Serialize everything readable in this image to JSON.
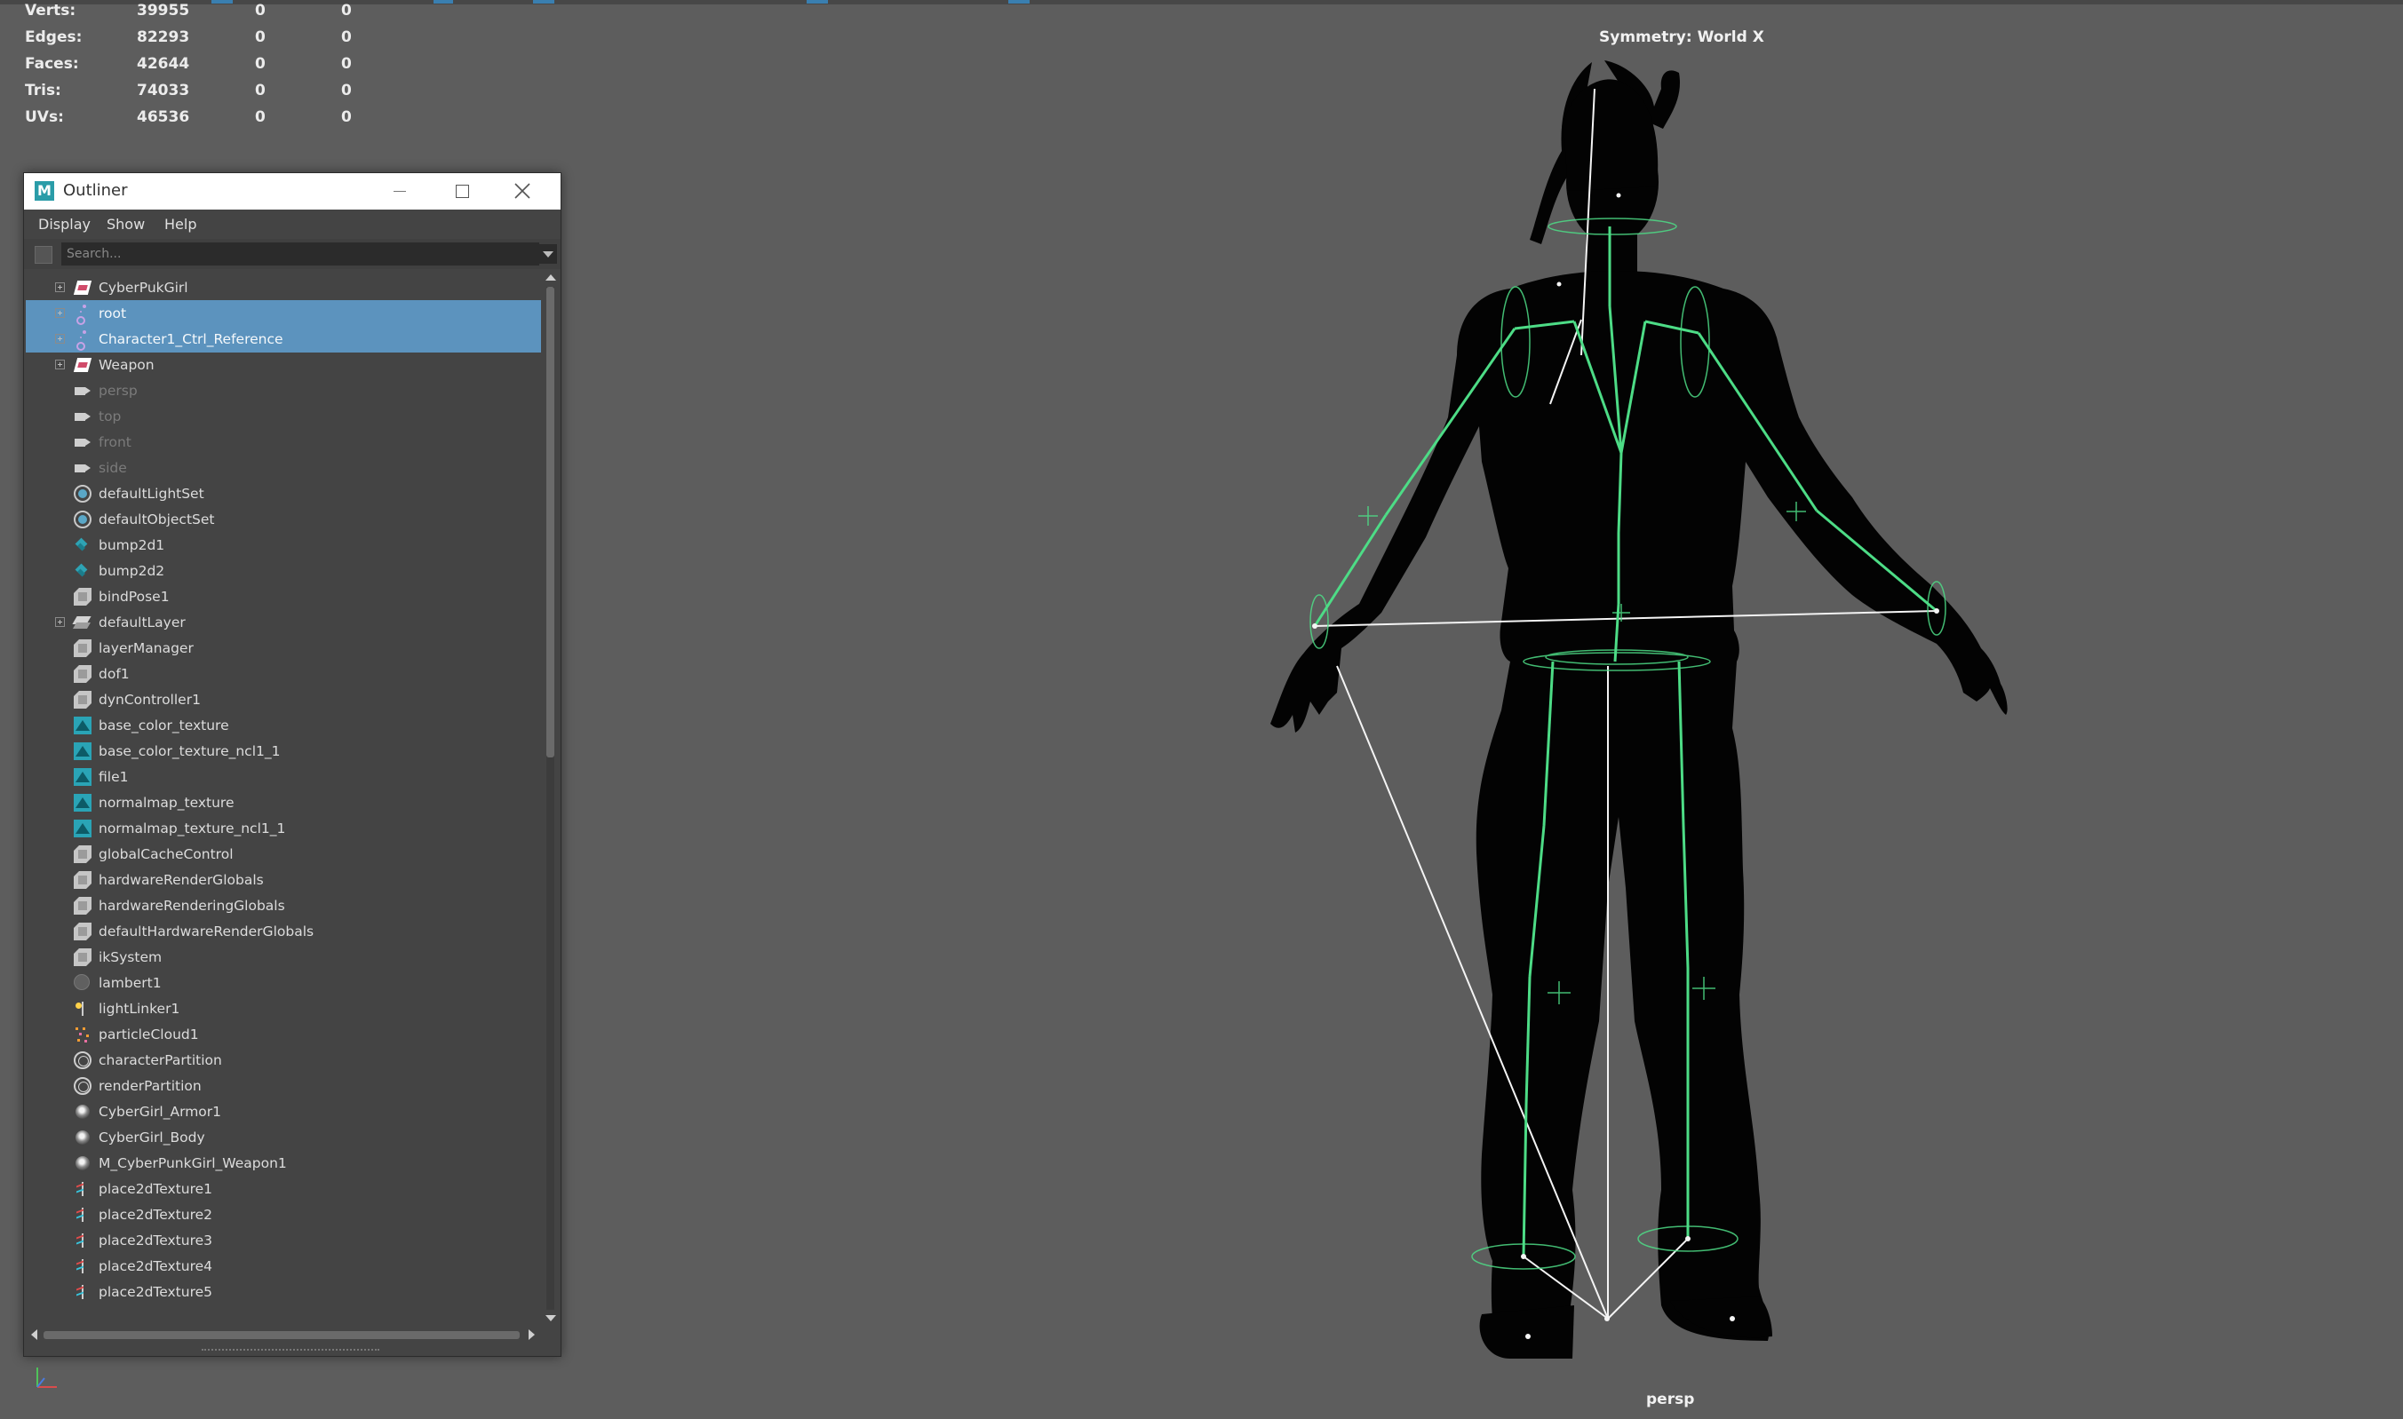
{
  "hud": {
    "rows": [
      {
        "label": "Verts:",
        "v1": "39955",
        "v2": "0",
        "v3": "0"
      },
      {
        "label": "Edges:",
        "v1": "82293",
        "v2": "0",
        "v3": "0"
      },
      {
        "label": "Faces:",
        "v1": "42644",
        "v2": "0",
        "v3": "0"
      },
      {
        "label": "Tris:",
        "v1": "74033",
        "v2": "0",
        "v3": "0"
      },
      {
        "label": "UVs:",
        "v1": "46536",
        "v2": "0",
        "v3": "0"
      }
    ]
  },
  "viewport": {
    "symmetry": "Symmetry: World X",
    "camera": "persp",
    "colors": {
      "background": "#5d5d5d",
      "bones": "#4ddc86",
      "ik": "#ffffff",
      "silhouette": "#020202"
    }
  },
  "outliner": {
    "title": "Outliner",
    "logo": "M",
    "menu": {
      "display": "Display",
      "show": "Show",
      "help": "Help"
    },
    "search_placeholder": "Search...",
    "items": [
      {
        "label": "CyberPukGirl",
        "icon": "transform-icon",
        "expand": true,
        "selected": false,
        "dim": false
      },
      {
        "label": "root",
        "icon": "joint-icon",
        "expand": true,
        "selected": true,
        "dim": false
      },
      {
        "label": "Character1_Ctrl_Reference",
        "icon": "control-rig-icon",
        "expand": true,
        "selected": true,
        "dim": false
      },
      {
        "label": "Weapon",
        "icon": "transform-icon",
        "expand": true,
        "selected": false,
        "dim": false
      },
      {
        "label": "persp",
        "icon": "camera-icon",
        "expand": false,
        "selected": false,
        "dim": true
      },
      {
        "label": "top",
        "icon": "camera-icon",
        "expand": false,
        "selected": false,
        "dim": true
      },
      {
        "label": "front",
        "icon": "camera-icon",
        "expand": false,
        "selected": false,
        "dim": true
      },
      {
        "label": "side",
        "icon": "camera-icon",
        "expand": false,
        "selected": false,
        "dim": true
      },
      {
        "label": "defaultLightSet",
        "icon": "set-icon",
        "expand": false,
        "selected": false,
        "dim": false
      },
      {
        "label": "defaultObjectSet",
        "icon": "set-icon",
        "expand": false,
        "selected": false,
        "dim": false
      },
      {
        "label": "bump2d1",
        "icon": "bump-icon",
        "expand": false,
        "selected": false,
        "dim": false
      },
      {
        "label": "bump2d2",
        "icon": "bump-icon",
        "expand": false,
        "selected": false,
        "dim": false
      },
      {
        "label": "bindPose1",
        "icon": "node-icon",
        "expand": false,
        "selected": false,
        "dim": false
      },
      {
        "label": "defaultLayer",
        "icon": "layer-icon",
        "expand": true,
        "selected": false,
        "dim": false
      },
      {
        "label": "layerManager",
        "icon": "node-icon",
        "expand": false,
        "selected": false,
        "dim": false
      },
      {
        "label": "dof1",
        "icon": "node-icon",
        "expand": false,
        "selected": false,
        "dim": false
      },
      {
        "label": "dynController1",
        "icon": "node-icon",
        "expand": false,
        "selected": false,
        "dim": false
      },
      {
        "label": "base_color_texture",
        "icon": "texture-icon",
        "expand": false,
        "selected": false,
        "dim": false
      },
      {
        "label": "base_color_texture_ncl1_1",
        "icon": "texture-icon",
        "expand": false,
        "selected": false,
        "dim": false
      },
      {
        "label": "file1",
        "icon": "texture-icon",
        "expand": false,
        "selected": false,
        "dim": false
      },
      {
        "label": "normalmap_texture",
        "icon": "texture-icon",
        "expand": false,
        "selected": false,
        "dim": false
      },
      {
        "label": "normalmap_texture_ncl1_1",
        "icon": "texture-icon",
        "expand": false,
        "selected": false,
        "dim": false
      },
      {
        "label": "globalCacheControl",
        "icon": "node-icon",
        "expand": false,
        "selected": false,
        "dim": false
      },
      {
        "label": "hardwareRenderGlobals",
        "icon": "node-icon",
        "expand": false,
        "selected": false,
        "dim": false
      },
      {
        "label": "hardwareRenderingGlobals",
        "icon": "node-icon",
        "expand": false,
        "selected": false,
        "dim": false
      },
      {
        "label": "defaultHardwareRenderGlobals",
        "icon": "node-icon",
        "expand": false,
        "selected": false,
        "dim": false
      },
      {
        "label": "ikSystem",
        "icon": "node-icon",
        "expand": false,
        "selected": false,
        "dim": false
      },
      {
        "label": "lambert1",
        "icon": "lambert-icon",
        "expand": false,
        "selected": false,
        "dim": false
      },
      {
        "label": "lightLinker1",
        "icon": "light-linker-icon",
        "expand": false,
        "selected": false,
        "dim": false
      },
      {
        "label": "particleCloud1",
        "icon": "particle-icon",
        "expand": false,
        "selected": false,
        "dim": false
      },
      {
        "label": "characterPartition",
        "icon": "partition-icon",
        "expand": false,
        "selected": false,
        "dim": false
      },
      {
        "label": "renderPartition",
        "icon": "partition-icon",
        "expand": false,
        "selected": false,
        "dim": false
      },
      {
        "label": "CyberGirl_Armor1",
        "icon": "shader-icon",
        "expand": false,
        "selected": false,
        "dim": false
      },
      {
        "label": "CyberGirl_Body",
        "icon": "shader-icon",
        "expand": false,
        "selected": false,
        "dim": false
      },
      {
        "label": "M_CyberPunkGirl_Weapon1",
        "icon": "shader-icon",
        "expand": false,
        "selected": false,
        "dim": false
      },
      {
        "label": "place2dTexture1",
        "icon": "place2d-icon",
        "expand": false,
        "selected": false,
        "dim": false
      },
      {
        "label": "place2dTexture2",
        "icon": "place2d-icon",
        "expand": false,
        "selected": false,
        "dim": false
      },
      {
        "label": "place2dTexture3",
        "icon": "place2d-icon",
        "expand": false,
        "selected": false,
        "dim": false
      },
      {
        "label": "place2dTexture4",
        "icon": "place2d-icon",
        "expand": false,
        "selected": false,
        "dim": false
      },
      {
        "label": "place2dTexture5",
        "icon": "place2d-icon",
        "expand": false,
        "selected": false,
        "dim": false
      }
    ]
  }
}
